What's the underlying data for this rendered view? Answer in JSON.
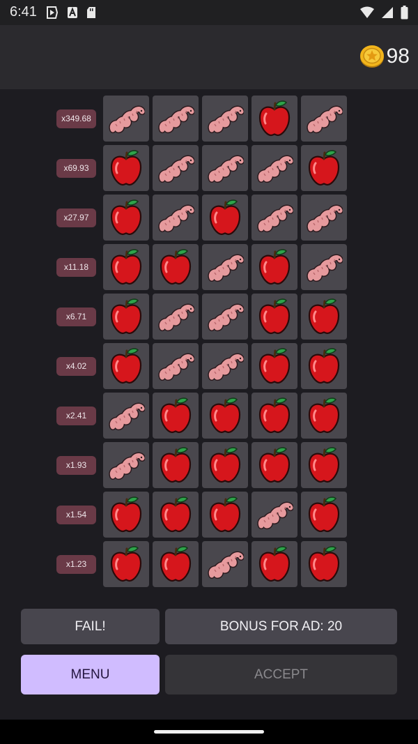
{
  "status_bar": {
    "time": "6:41",
    "left_icons": [
      "play-icon",
      "a-icon",
      "sd-card-icon"
    ],
    "right_icons": [
      "wifi-icon",
      "signal-icon",
      "battery-icon"
    ]
  },
  "header": {
    "coin_icon": "coin-icon",
    "coins": "98"
  },
  "grid": {
    "rows": [
      {
        "multiplier": "x349.68",
        "cells": [
          "worm",
          "worm",
          "worm",
          "apple",
          "worm"
        ]
      },
      {
        "multiplier": "x69.93",
        "cells": [
          "apple",
          "worm",
          "worm",
          "worm",
          "apple"
        ]
      },
      {
        "multiplier": "x27.97",
        "cells": [
          "apple",
          "worm",
          "apple",
          "worm",
          "worm"
        ]
      },
      {
        "multiplier": "x11.18",
        "cells": [
          "apple",
          "apple",
          "worm",
          "apple",
          "worm"
        ]
      },
      {
        "multiplier": "x6.71",
        "cells": [
          "apple",
          "worm",
          "worm",
          "apple",
          "apple"
        ]
      },
      {
        "multiplier": "x4.02",
        "cells": [
          "apple",
          "worm",
          "worm",
          "apple",
          "apple"
        ]
      },
      {
        "multiplier": "x2.41",
        "cells": [
          "worm",
          "apple",
          "apple",
          "apple",
          "apple"
        ]
      },
      {
        "multiplier": "x1.93",
        "cells": [
          "worm",
          "apple",
          "apple",
          "apple",
          "apple"
        ]
      },
      {
        "multiplier": "x1.54",
        "cells": [
          "apple",
          "apple",
          "apple",
          "worm",
          "apple"
        ]
      },
      {
        "multiplier": "x1.23",
        "cells": [
          "apple",
          "apple",
          "worm",
          "apple",
          "apple"
        ]
      }
    ]
  },
  "actions": {
    "fail_label": "FAIL!",
    "bonus_label": "BONUS FOR AD: 20",
    "menu_label": "MENU",
    "accept_label": "ACCEPT"
  },
  "colors": {
    "background": "#1d1c21",
    "tile": "#49474d",
    "multiplier_badge": "#6a3a47",
    "menu_button": "#d0bcff"
  }
}
